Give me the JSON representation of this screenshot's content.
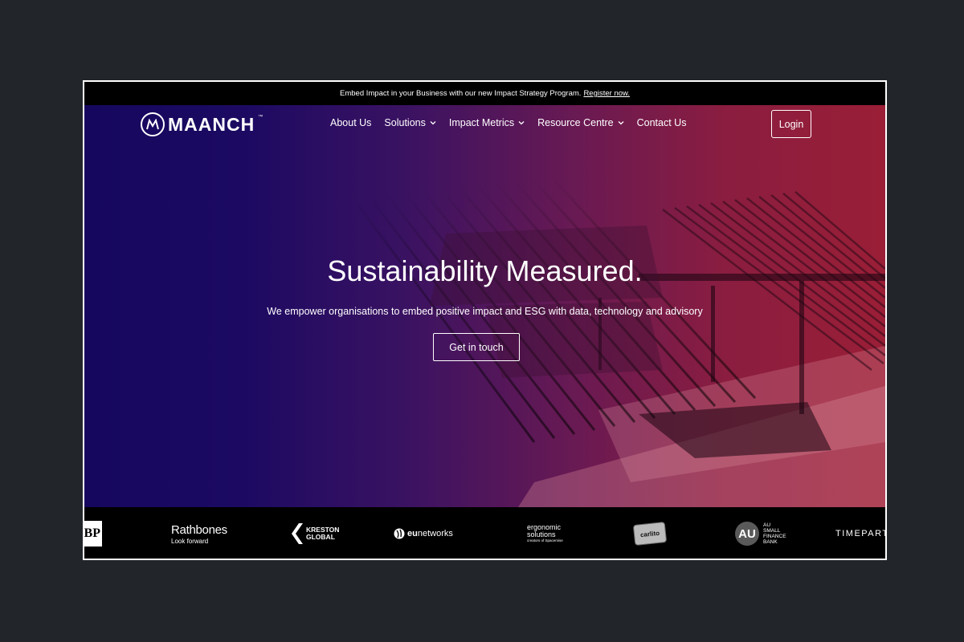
{
  "announcement": {
    "text": "Embed Impact in your Business with our new Impact Strategy Program.",
    "link": "Register now."
  },
  "header": {
    "logo": "MAANCH",
    "logo_tm": "™",
    "menu": [
      {
        "label": "About Us",
        "icon": null
      },
      {
        "label": "Solutions",
        "icon": "chevron-down-icon"
      },
      {
        "label": "Impact Metrics",
        "icon": "chevron-down-icon"
      },
      {
        "label": "Resource Centre",
        "icon": "chevron-down-icon"
      },
      {
        "label": "Contact Us",
        "icon": null
      }
    ],
    "login_label": "Login"
  },
  "hero": {
    "headline": "Sustainability Measured.",
    "subline": "We empower organisations to embed positive impact and ESG with data, technology and advisory",
    "cta_label": "Get in touch"
  },
  "partners": {
    "ibp": "IBP",
    "rathbones_name": "Rathbones",
    "rathbones_tag": "Look forward",
    "kreston_1": "KRESTON",
    "kreston_2": "GLOBAL",
    "eunetworks_bold": "eu",
    "eunetworks_rest": "networks",
    "ergonomic_1": "ergonomic",
    "ergonomic_2": "solutions",
    "ergonomic_3": "creators of Spacemise",
    "carlito": "carlito",
    "au_mark": "AU",
    "au_1": "AU",
    "au_2": "SMALL",
    "au_3": "FINANCE",
    "au_4": "BANK",
    "timepart": "TIMEPART"
  },
  "colors": {
    "gradient_left": "#16075e",
    "gradient_right": "#9a1e36",
    "page_bg": "#22262a"
  }
}
